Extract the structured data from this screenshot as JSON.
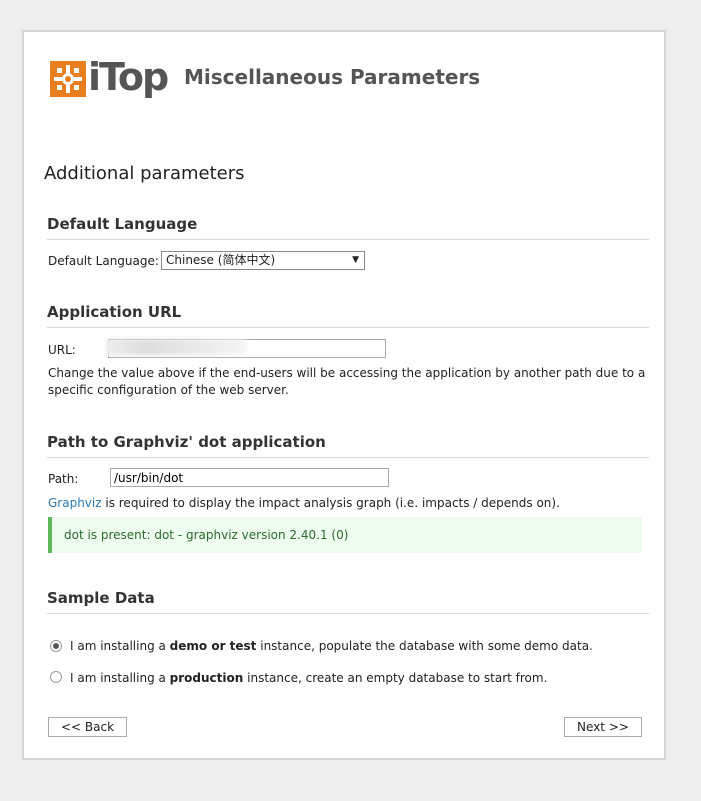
{
  "header": {
    "logo_text": "iTop",
    "title": "Miscellaneous Parameters"
  },
  "subtitle": "Additional parameters",
  "language": {
    "heading": "Default Language",
    "label": "Default Language:",
    "selected": "Chinese (简体中文)"
  },
  "app_url": {
    "heading": "Application URL",
    "label": "URL:",
    "value": "",
    "help": "Change the value above if the end-users will be accessing the application by another path due to a specific configuration of the web server."
  },
  "graphviz": {
    "heading": "Path to Graphviz' dot application",
    "label": "Path:",
    "value": "/usr/bin/dot",
    "link": "Graphviz",
    "help_rest": " is required to display the impact analysis graph (i.e. impacts / depends on).",
    "status": "dot is present: dot - graphviz version 2.40.1 (0)"
  },
  "sample": {
    "heading": "Sample Data",
    "opt1_pre": "I am installing a ",
    "opt1_bold": "demo or test",
    "opt1_post": " instance, populate the database with some demo data.",
    "opt2_pre": "I am installing a ",
    "opt2_bold": "production",
    "opt2_post": " instance, create an empty database to start from.",
    "selected": 1
  },
  "nav": {
    "back": "<< Back",
    "next": "Next >>"
  },
  "colors": {
    "brand": "#ea7d1e",
    "success_border": "#5cb85c",
    "link": "#2a7ab0"
  }
}
